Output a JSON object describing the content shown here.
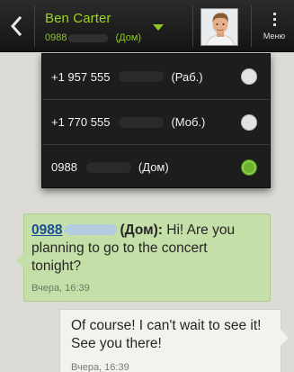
{
  "header": {
    "contact_name": "Ben Carter",
    "number_prefix": "0988",
    "number_type": "(Дом)",
    "menu_label": "Меню"
  },
  "icons": {
    "back": "chevron-left-icon",
    "dropdown": "caret-down-icon",
    "menu": "overflow-menu-icon",
    "avatar": "contact-avatar"
  },
  "dropdown": {
    "items": [
      {
        "prefix": "+1 957 555",
        "type": "(Раб.)",
        "selected": false
      },
      {
        "prefix": "+1 770 555",
        "type": "(Моб.)",
        "selected": false
      },
      {
        "prefix": "0988",
        "type": "(Дом)",
        "selected": true
      }
    ]
  },
  "messages": {
    "incoming": {
      "sender_number": "0988",
      "sender_type": "(Дом):",
      "text": "Hi! Are you planning to go to the concert tonight?",
      "time": "Вчера, 16:39"
    },
    "outgoing": {
      "text": "Of course! I can't wait to see it! See you there!",
      "time": "Вчера, 16:39"
    }
  },
  "colors": {
    "accent_green": "#9bd51f",
    "incoming_bubble": "#c5dfa8",
    "outgoing_bubble": "#f2f2ef",
    "link_blue": "#1b4d9a",
    "radio_checked": "#6cb32f"
  }
}
